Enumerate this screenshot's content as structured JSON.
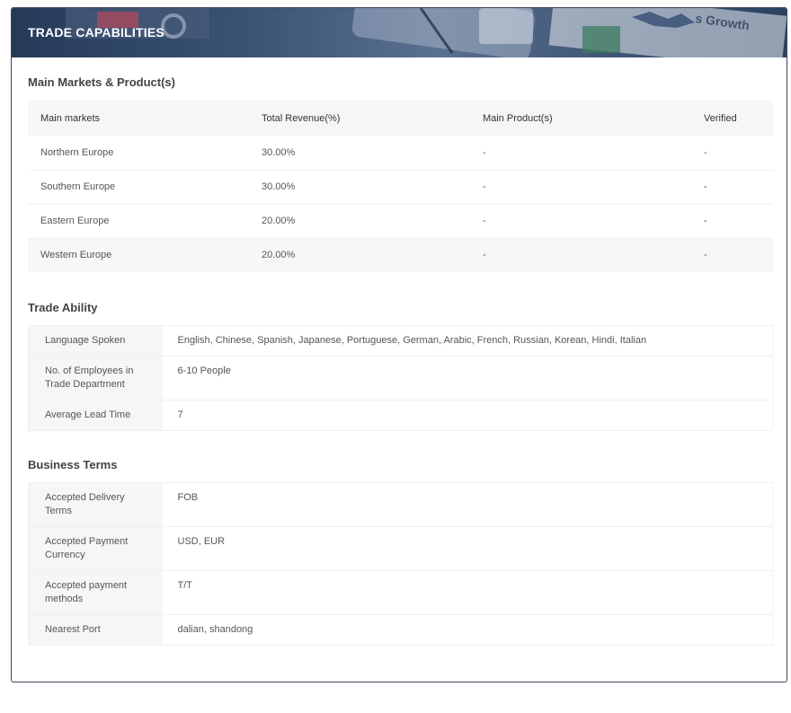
{
  "banner": {
    "title": "TRADE CAPABILITIES",
    "photo_text": "s Growth"
  },
  "markets": {
    "title": "Main Markets & Product(s)",
    "columns": [
      "Main markets",
      "Total Revenue(%)",
      "Main Product(s)",
      "Verified"
    ],
    "rows": [
      [
        "Northern Europe",
        "30.00%",
        "-",
        "-"
      ],
      [
        "Southern Europe",
        "30.00%",
        "-",
        "-"
      ],
      [
        "Eastern Europe",
        "20.00%",
        "-",
        "-"
      ],
      [
        "Western Europe",
        "20.00%",
        "-",
        "-"
      ]
    ]
  },
  "trade_ability": {
    "title": "Trade Ability",
    "rows": [
      {
        "key": "Language Spoken",
        "value": "English, Chinese, Spanish, Japanese, Portuguese, German, Arabic, French, Russian, Korean, Hindi, Italian"
      },
      {
        "key": "No. of Employees in Trade Department",
        "value": "6-10 People"
      },
      {
        "key": "Average Lead Time",
        "value": "7"
      }
    ]
  },
  "business_terms": {
    "title": "Business Terms",
    "rows": [
      {
        "key": "Accepted Delivery Terms",
        "value": "FOB"
      },
      {
        "key": "Accepted Payment Currency",
        "value": "USD, EUR"
      },
      {
        "key": "Accepted payment methods",
        "value": "T/T"
      },
      {
        "key": "Nearest Port",
        "value": "dalian, shandong"
      }
    ]
  }
}
